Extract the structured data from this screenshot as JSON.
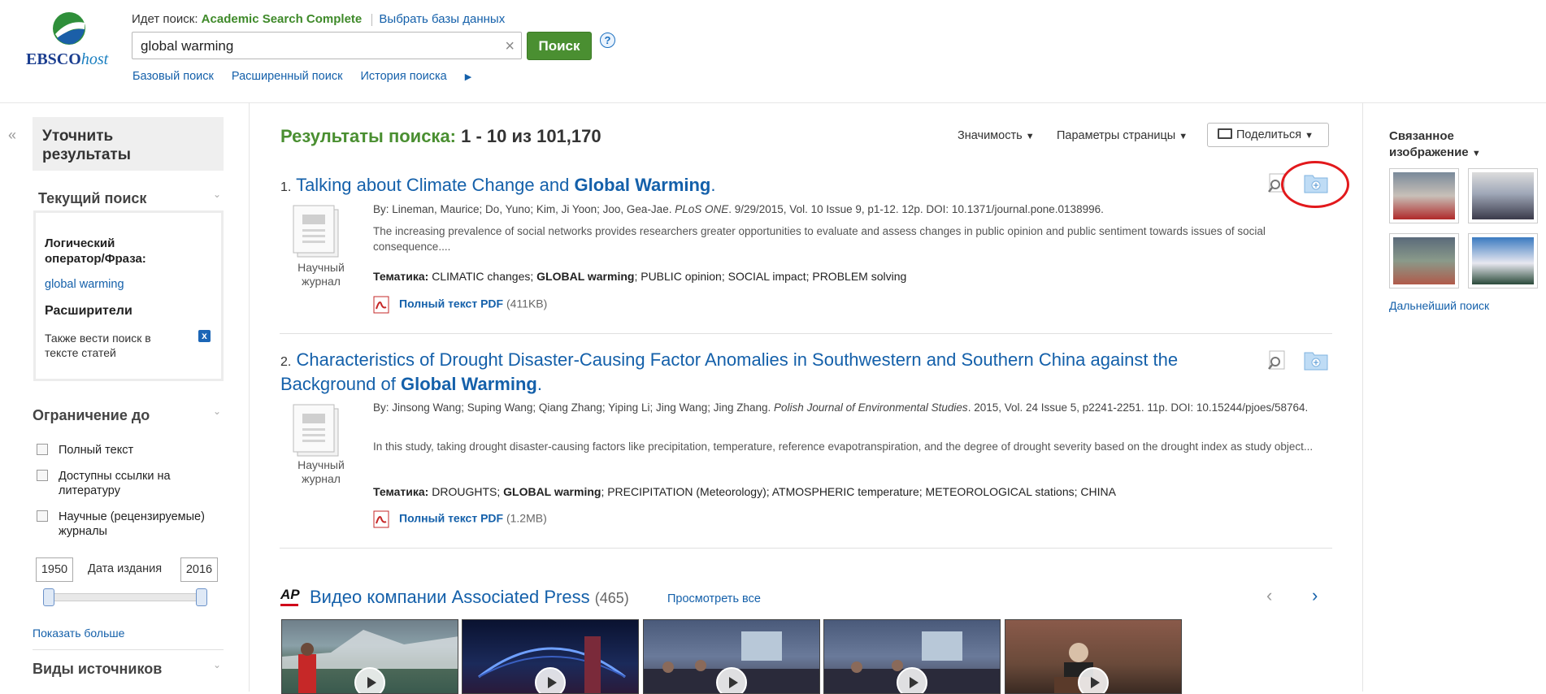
{
  "header": {
    "logo_text": "EBSCO",
    "logo_italic": "host",
    "searching_label": "Идет поиск:",
    "database": "Academic Search Complete",
    "choose_databases": "Выбрать базы данных",
    "search_value": "global warming",
    "search_button": "Поиск",
    "help": "?",
    "nav": [
      "Базовый поиск",
      "Расширенный поиск",
      "История поиска"
    ]
  },
  "sidebar": {
    "collapse": "«",
    "refine_line1": "Уточнить",
    "refine_line2": "результаты",
    "current_search_title": "Текущий поиск",
    "boolean_label_line1": "Логический",
    "boolean_label_line2": "оператор/Фраза:",
    "boolean_value": "global warming",
    "expanders_title": "Расширители",
    "expander_line1": "Также вести поиск в",
    "expander_line2": "тексте статей",
    "expander_remove": "x",
    "limit_title": "Ограничение до",
    "limiters": [
      {
        "line1": "Полный текст",
        "line2": ""
      },
      {
        "line1": "Доступны ссылки на",
        "line2": "литературу"
      },
      {
        "line1": "Научные (рецензируемые)",
        "line2": "журналы"
      }
    ],
    "year_from": "1950",
    "year_label": "Дата издания",
    "year_to": "2016",
    "show_more": "Показать больше",
    "source_types_title": "Виды источников"
  },
  "results": {
    "heading_label": "Результаты поиска:",
    "heading_count": "1 - 10 из 101,170",
    "relevance": "Значимость",
    "page_options": "Параметры страницы",
    "share": "Поделиться",
    "items": [
      {
        "num": "1.",
        "title_part1": "Talking about Climate Change and ",
        "title_bold": "Global Warming",
        "title_part2": ".",
        "type_line1": "Научный",
        "type_line2": "журнал",
        "meta_authors": "By: Lineman, Maurice; Do, Yuno; Kim, Ji Yoon; Joo, Gea-Jae. ",
        "meta_source": "PLoS ONE",
        "meta_rest": ". 9/29/2015, Vol. 10 Issue 9, p1-12. 12p. DOI: 10.1371/journal.pone.0138996.",
        "abstract": "The increasing prevalence of social networks provides researchers greater opportunities to evaluate and assess changes in public opinion and public sentiment towards issues of social consequence....",
        "subjects_label": "Тематика:",
        "subjects_a": " CLIMATIC changes; ",
        "subjects_bold": "GLOBAL warming",
        "subjects_b": "; PUBLIC opinion; SOCIAL impact; PROBLEM solving",
        "pdf_label": "Полный текст PDF",
        "pdf_size": "(411KB)"
      },
      {
        "num": "2.",
        "title_part1": "Characteristics of Drought Disaster-Causing Factor Anomalies in Southwestern and Southern China against the Background of ",
        "title_bold": "Global Warming",
        "title_part2": ".",
        "type_line1": "Научный",
        "type_line2": "журнал",
        "meta_authors": "By: Jinsong Wang; Suping Wang; Qiang Zhang; Yiping Li; Jing Wang; Jing Zhang. ",
        "meta_source": "Polish Journal of Environmental Studies",
        "meta_rest": ". 2015, Vol. 24 Issue 5, p2241-2251. 11p. DOI: 10.15244/pjoes/58764.",
        "abstract": "In this study, taking drought disaster-causing factors like precipitation, temperature, reference evapotranspiration, and the degree of drought severity based on the drought index as study object...",
        "subjects_label": "Тематика:",
        "subjects_a": " DROUGHTS; ",
        "subjects_bold": "GLOBAL warming",
        "subjects_b": "; PRECIPITATION (Meteorology); ATMOSPHERIC temperature; METEOROLOGICAL stations; CHINA",
        "pdf_label": "Полный текст PDF",
        "pdf_size": "(1.2MB)"
      }
    ]
  },
  "ap_videos": {
    "logo": "AP",
    "title": "Видео компании Associated Press",
    "count": "(465)",
    "view_all": "Просмотреть все",
    "prev": "‹",
    "next": "›"
  },
  "related": {
    "title_line1": "Связанное",
    "title_line2": "изображение",
    "further_search": "Дальнейший поиск"
  },
  "colors": {
    "brand_green": "#4a8f31",
    "link_blue": "#1460aa",
    "highlight_red": "#e2191c"
  }
}
